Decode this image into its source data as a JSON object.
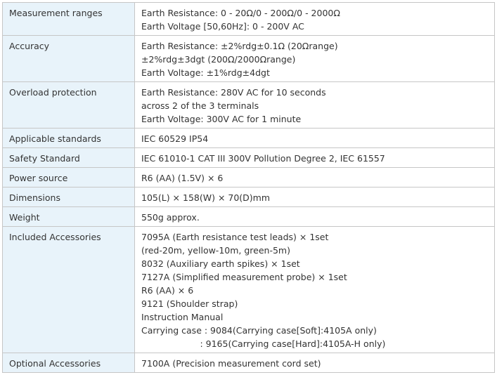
{
  "spec_table": {
    "rows": [
      {
        "label": "Measurement ranges",
        "lines": [
          "Earth Resistance: 0 - 20Ω/0 - 200Ω/0 - 2000Ω",
          "Earth Voltage [50,60Hz]: 0 - 200V AC"
        ]
      },
      {
        "label": "Accuracy",
        "lines": [
          "Earth Resistance: ±2%rdg±0.1Ω (20Ωrange)",
          "±2%rdg±3dgt (200Ω/2000Ωrange)",
          "Earth Voltage: ±1%rdg±4dgt"
        ]
      },
      {
        "label": "Overload protection",
        "lines": [
          "Earth Resistance: 280V AC for 10 seconds",
          "across 2 of the 3 terminals",
          "Earth Voltage: 300V AC for 1 minute"
        ]
      },
      {
        "label": "Applicable standards",
        "lines": [
          "IEC 60529 IP54"
        ]
      },
      {
        "label": "Safety Standard",
        "lines": [
          "IEC 61010-1 CAT III 300V Pollution Degree 2, IEC 61557"
        ]
      },
      {
        "label": "Power source",
        "lines": [
          "R6 (AA) (1.5V) × 6"
        ]
      },
      {
        "label": "Dimensions",
        "lines": [
          "105(L) × 158(W) × 70(D)mm"
        ]
      },
      {
        "label": "Weight",
        "lines": [
          "550g approx."
        ]
      },
      {
        "label": "Included Accessories",
        "lines": [
          "7095A (Earth resistance test leads) × 1set",
          "(red-20m, yellow-10m, green-5m)",
          "8032 (Auxiliary earth spikes) × 1set",
          "7127A (Simplified measurement probe) × 1set",
          "R6 (AA) × 6",
          "9121 (Shoulder strap)",
          "Instruction Manual",
          "Carrying case : 9084(Carrying case[Soft]:4105A only)",
          "                     : 9165(Carrying case[Hard]:4105A-H only)"
        ]
      },
      {
        "label": "Optional Accessories",
        "lines": [
          "7100A (Precision measurement cord set)"
        ]
      }
    ]
  }
}
